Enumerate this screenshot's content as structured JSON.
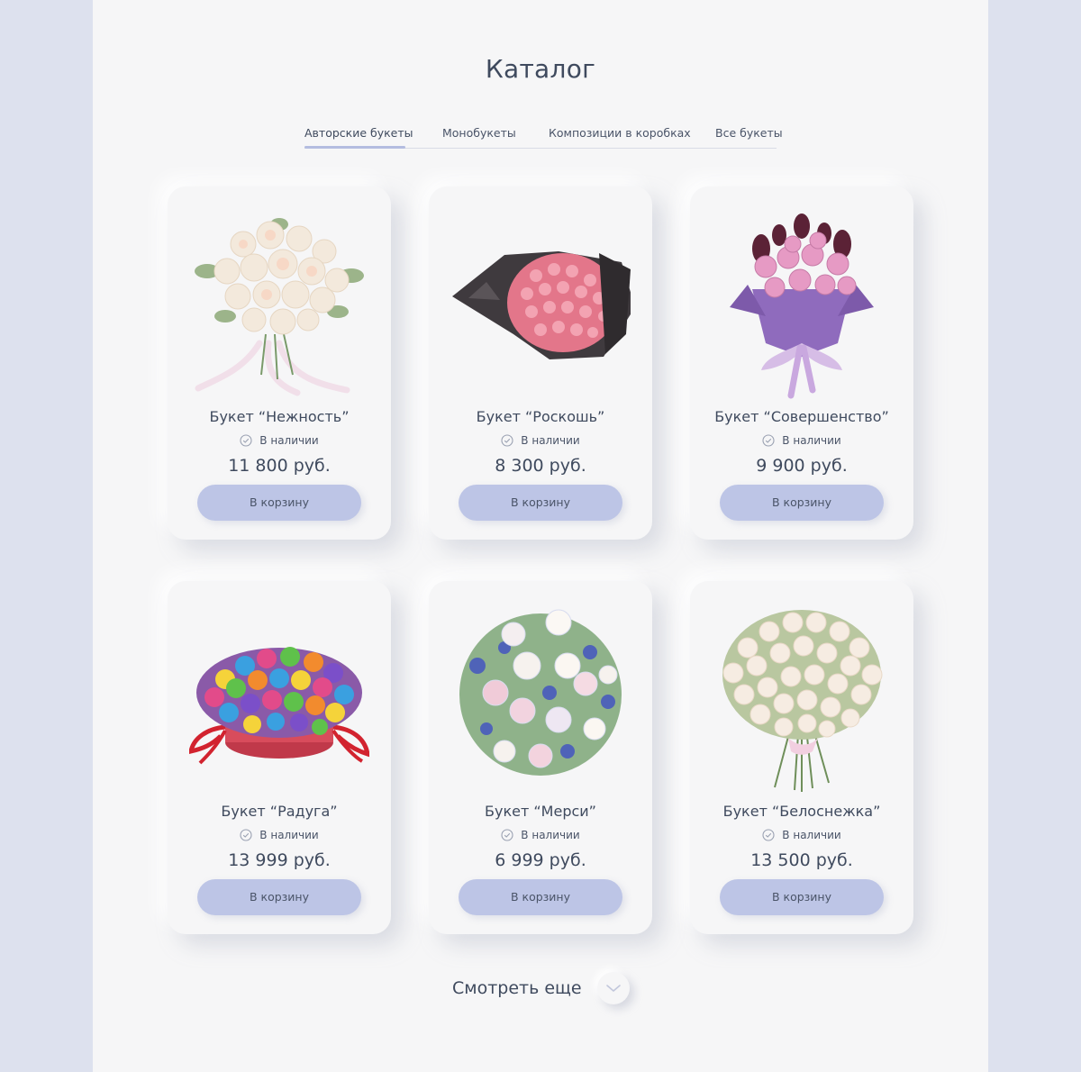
{
  "catalog": {
    "title": "Каталог",
    "tabs": [
      {
        "label": "Авторские букеты",
        "active": true
      },
      {
        "label": "Монобукеты",
        "active": false
      },
      {
        "label": "Композиции в коробках",
        "active": false
      },
      {
        "label": "Все букеты",
        "active": false
      }
    ],
    "stock_label": "В наличии",
    "cart_label": "В корзину",
    "products": [
      {
        "name": "Букет “Нежность”",
        "price": "11 800 руб.",
        "image": "cream-peony-bouquet-with-white-ribbon"
      },
      {
        "name": "Букет “Роскошь”",
        "price": "8 300 руб.",
        "image": "pink-spray-roses-in-black-wrap"
      },
      {
        "name": "Букет “Совершенство”",
        "price": "9 900 руб.",
        "image": "pink-roses-and-dark-callas-in-lilac-wrap"
      },
      {
        "name": "Букет “Радуга”",
        "price": "13 999 руб.",
        "image": "rainbow-roses-in-red-hatbox"
      },
      {
        "name": "Букет “Мерси”",
        "price": "6 999 руб.",
        "image": "white-pink-roses-with-blue-eryngium"
      },
      {
        "name": "Букет “Белоснежка”",
        "price": "13 500 руб.",
        "image": "white-spray-roses-bouquet"
      }
    ],
    "more_label": "Смотреть еще"
  },
  "colors": {
    "page_bg": "#f6f6f7",
    "side_bg": "#dde1ee",
    "accent": "#bdc5e6",
    "text": "#3f4a5e"
  }
}
